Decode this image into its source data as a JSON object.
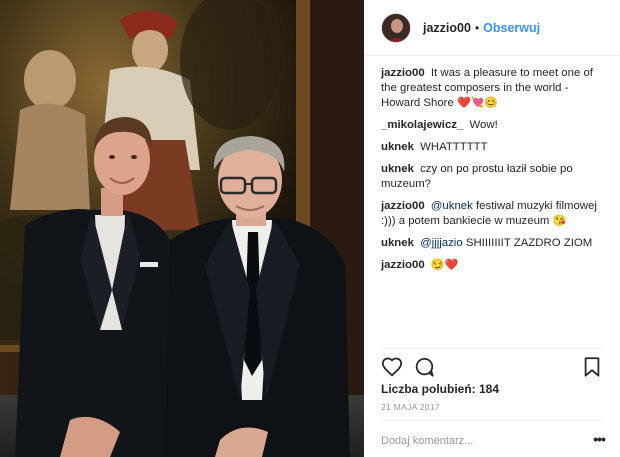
{
  "post": {
    "username": "jazzio00",
    "separator": "•",
    "follow_label": "Obserwuj",
    "comments": [
      {
        "author": "jazzio00",
        "text": "It was a pleasure to meet one of the greatest composers in the world - Howard Shore",
        "emoji": "❤️💘😊"
      },
      {
        "author": "_mikolajewicz_",
        "text": "Wow!"
      },
      {
        "author": "uknek",
        "text": "WHATTTTTT"
      },
      {
        "author": "uknek",
        "text": "czy on po prostu łaził sobie po muzeum?"
      },
      {
        "author": "jazzio00",
        "mention": "@uknek",
        "text": "festiwal muzyki filmowej :))) a potem bankiecie w muzeum",
        "emoji": "😘"
      },
      {
        "author": "uknek",
        "mention": "@jjjjazio",
        "text": "SHIIIIIIIT ZAZDRO ZIOM"
      },
      {
        "author": "jazzio00",
        "text": "",
        "emoji": "😏❤️"
      }
    ],
    "likes_label": "Liczba polubień: 184",
    "date": "21 MAJA 2017",
    "comment_placeholder": "Dodaj komentarz...",
    "more_label": "•••"
  },
  "icons": {
    "like": "heart-icon",
    "comment": "comment-bubble-icon",
    "save": "bookmark-icon",
    "options": "more-options-icon"
  },
  "colors": {
    "link_blue": "#3897f0",
    "mention_blue": "#003569",
    "text": "#262626",
    "muted": "#999999",
    "divider": "#efefef"
  }
}
